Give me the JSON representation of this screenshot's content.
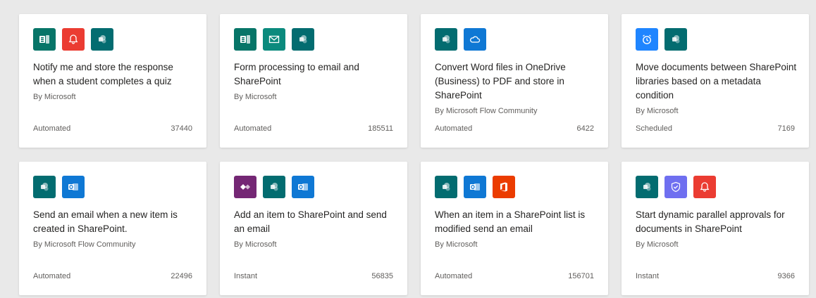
{
  "templates": [
    {
      "title": "Notify me and store the response when a student completes a quiz",
      "author": "By Microsoft",
      "type": "Automated",
      "count": "37440",
      "icons": [
        "forms-icon",
        "notification-icon",
        "sharepoint-icon"
      ]
    },
    {
      "title": "Form processing to email and SharePoint",
      "author": "By Microsoft",
      "type": "Automated",
      "count": "185511",
      "icons": [
        "forms-icon",
        "mail-icon",
        "sharepoint-icon"
      ]
    },
    {
      "title": "Convert Word files in OneDrive (Business) to PDF and store in SharePoint",
      "author": "By Microsoft Flow Community",
      "type": "Automated",
      "count": "6422",
      "icons": [
        "sharepoint-icon",
        "onedrive-icon"
      ]
    },
    {
      "title": "Move documents between SharePoint libraries based on a metadata condition",
      "author": "By Microsoft",
      "type": "Scheduled",
      "count": "7169",
      "icons": [
        "schedule-icon",
        "sharepoint-icon"
      ]
    },
    {
      "title": "Send an email when a new item is created in SharePoint.",
      "author": "By Microsoft Flow Community",
      "type": "Automated",
      "count": "22496",
      "icons": [
        "sharepoint-icon",
        "outlook-icon"
      ]
    },
    {
      "title": "Add an item to SharePoint and send an email",
      "author": "By Microsoft",
      "type": "Instant",
      "count": "56835",
      "icons": [
        "powerapps-icon",
        "sharepoint-icon",
        "outlook-icon"
      ]
    },
    {
      "title": "When an item in a SharePoint list is modified send an email",
      "author": "By Microsoft",
      "type": "Automated",
      "count": "156701",
      "icons": [
        "sharepoint-icon",
        "outlook-icon",
        "office365-icon"
      ]
    },
    {
      "title": "Start dynamic parallel approvals for documents in SharePoint",
      "author": "By Microsoft",
      "type": "Instant",
      "count": "9366",
      "icons": [
        "sharepoint-icon",
        "approvals-icon",
        "notification-icon"
      ]
    }
  ],
  "icon_colors": {
    "forms-icon": "#077568",
    "notification-icon": "#eb3c32",
    "sharepoint-icon": "#036c70",
    "mail-icon": "#0b8a7d",
    "onedrive-icon": "#0f78d4",
    "schedule-icon": "#1f85ff",
    "outlook-icon": "#0f78d4",
    "powerapps-icon": "#742774",
    "office365-icon": "#eb3c00",
    "approvals-icon": "#6f6ff0"
  }
}
